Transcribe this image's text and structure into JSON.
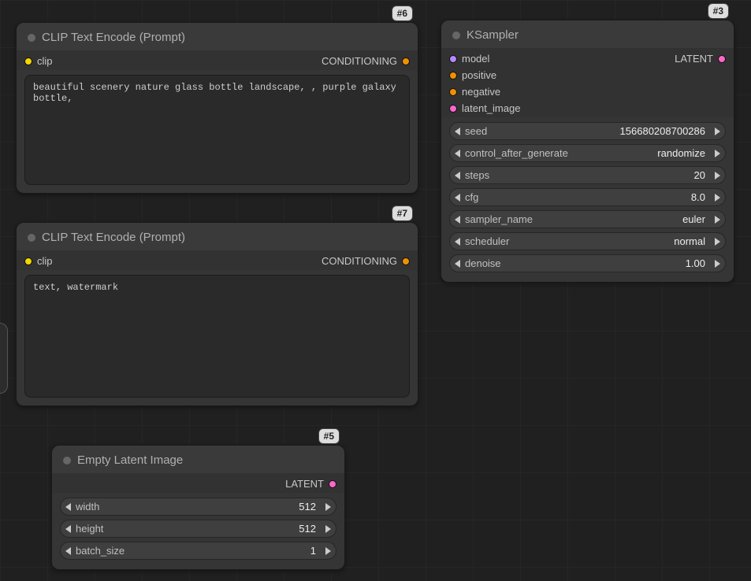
{
  "nodes": {
    "clip_pos": {
      "badge": "#6",
      "title": "CLIP Text Encode (Prompt)",
      "input": "clip",
      "output": "CONDITIONING",
      "text": "beautiful scenery nature glass bottle landscape, , purple galaxy bottle,"
    },
    "clip_neg": {
      "badge": "#7",
      "title": "CLIP Text Encode (Prompt)",
      "input": "clip",
      "output": "CONDITIONING",
      "text": "text, watermark"
    },
    "latent": {
      "badge": "#5",
      "title": "Empty Latent Image",
      "output": "LATENT",
      "widgets": {
        "width": {
          "label": "width",
          "value": "512"
        },
        "height": {
          "label": "height",
          "value": "512"
        },
        "batch_size": {
          "label": "batch_size",
          "value": "1"
        }
      }
    },
    "ksampler": {
      "badge": "#3",
      "title": "KSampler",
      "inputs": {
        "model": "model",
        "positive": "positive",
        "negative": "negative",
        "latent_image": "latent_image"
      },
      "output": "LATENT",
      "widgets": {
        "seed": {
          "label": "seed",
          "value": "156680208700286"
        },
        "cag": {
          "label": "control_after_generate",
          "value": "randomize"
        },
        "steps": {
          "label": "steps",
          "value": "20"
        },
        "cfg": {
          "label": "cfg",
          "value": "8.0"
        },
        "sampler_name": {
          "label": "sampler_name",
          "value": "euler"
        },
        "scheduler": {
          "label": "scheduler",
          "value": "normal"
        },
        "denoise": {
          "label": "denoise",
          "value": "1.00"
        }
      }
    }
  }
}
